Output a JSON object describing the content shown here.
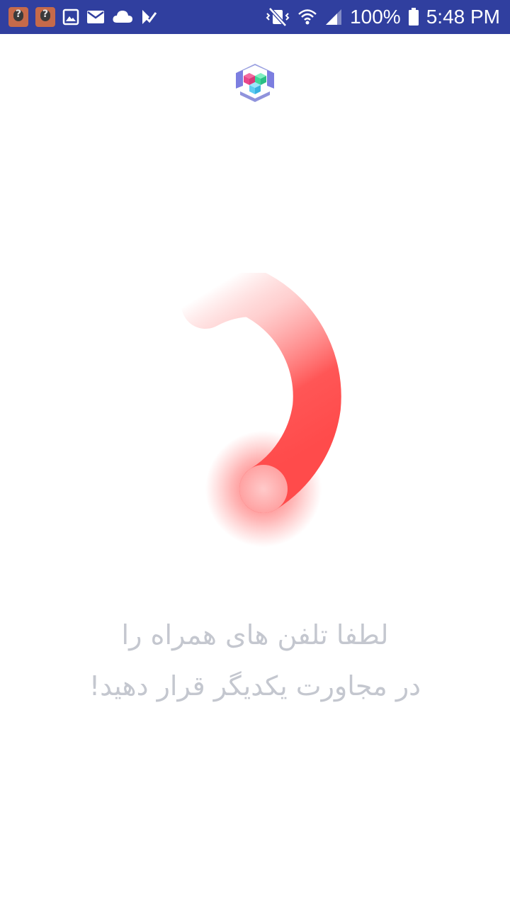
{
  "status_bar": {
    "battery_percent": "100%",
    "time": "5:48 PM",
    "background_color": "#303f9f",
    "notification_icons": [
      "contact-avatar-icon",
      "contact-avatar-icon",
      "image-icon",
      "email-icon",
      "cloud-icon",
      "checkmark-icon"
    ],
    "system_icons": [
      "vibrate-mute-icon",
      "wifi-icon",
      "signal-icon",
      "battery-icon"
    ]
  },
  "app": {
    "logo_icon": "cube-logo-icon",
    "spinner_color": "#ff4b4b",
    "instruction_line1": "لطفا تلفن های همراه را",
    "instruction_line2": "در مجاورت یکدیگر قرار دهید!",
    "text_color": "#c4c7cf"
  }
}
